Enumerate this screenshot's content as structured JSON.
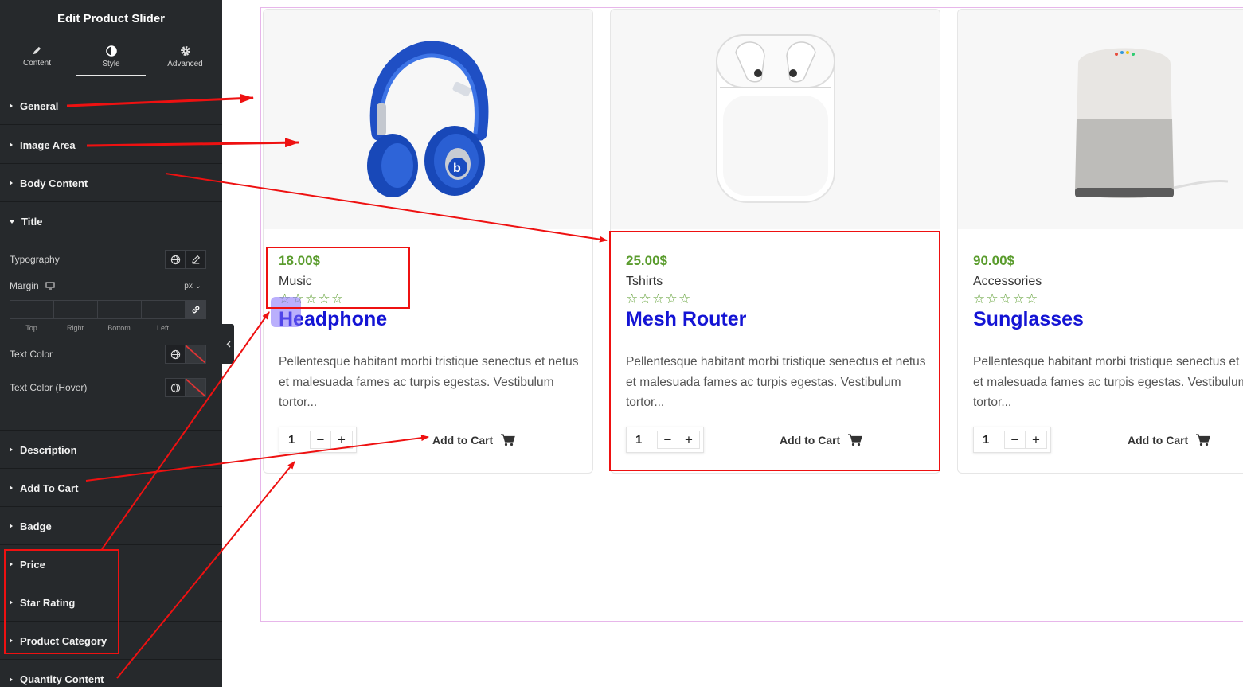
{
  "sidebar": {
    "title": "Edit Product Slider",
    "tabs": [
      {
        "label": "Content",
        "icon": "pencil-icon"
      },
      {
        "label": "Style",
        "icon": "contrast-icon"
      },
      {
        "label": "Advanced",
        "icon": "gear-icon"
      }
    ],
    "active_tab": "Style",
    "sections_top": [
      "General",
      "Image Area",
      "Body Content"
    ],
    "open_section": "Title",
    "title_controls": {
      "typography_label": "Typography",
      "margin_label": "Margin",
      "margin_unit": "px",
      "margin_sides": [
        "Top",
        "Right",
        "Bottom",
        "Left"
      ],
      "text_color_label": "Text Color",
      "text_color_hover_label": "Text Color (Hover)"
    },
    "sections_bottom": [
      "Description",
      "Add To Cart",
      "Badge",
      "Price",
      "Star Rating",
      "Product Category",
      "Quantity Content"
    ]
  },
  "products": [
    {
      "price": "18.00$",
      "category": "Music",
      "title": "Headphone",
      "description": "Pellentesque habitant morbi tristique senectus et netus et malesuada fames ac turpis egestas. Vestibulum tortor...",
      "quantity": "1",
      "add_to_cart": "Add to Cart",
      "image": "headphone",
      "rating": 0
    },
    {
      "price": "25.00$",
      "category": "Tshirts",
      "title": "Mesh Router",
      "description": "Pellentesque habitant morbi tristique senectus et netus et malesuada fames ac turpis egestas. Vestibulum tortor...",
      "quantity": "1",
      "add_to_cart": "Add to Cart",
      "image": "airpods",
      "rating": 0
    },
    {
      "price": "90.00$",
      "category": "Accessories",
      "title": "Sunglasses",
      "description": "Pellentesque habitant morbi tristique senectus et netus et malesuada fames ac turpis egestas. Vestibulum tortor...",
      "quantity": "1",
      "add_to_cart": "Add to Cart",
      "image": "smart-speaker",
      "rating": 0
    }
  ],
  "qty_minus": "−",
  "qty_plus": "+",
  "star_glyph": "☆",
  "colors": {
    "sidebar_bg": "#26292c",
    "price_green": "#5a9c2d",
    "title_blue": "#1414d4",
    "annotation_red": "#e11111"
  }
}
